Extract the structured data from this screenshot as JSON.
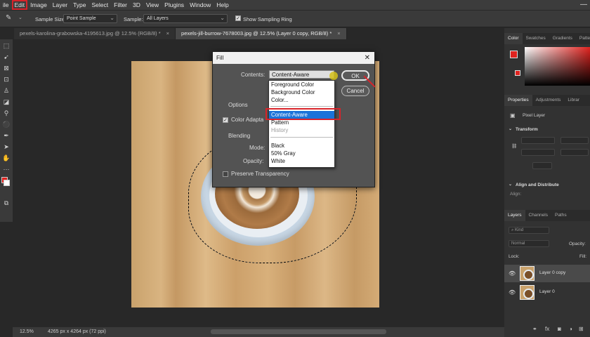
{
  "menu": [
    "ile",
    "Edit",
    "Image",
    "Layer",
    "Type",
    "Select",
    "Filter",
    "3D",
    "View",
    "Plugins",
    "Window",
    "Help"
  ],
  "options_bar": {
    "sample_size_label": "Sample Size:",
    "sample_size_value": "Point Sample",
    "sample_label": "Sample:",
    "sample_value": "All Layers",
    "show_ring_label": "Show Sampling Ring"
  },
  "tabs": [
    {
      "label": "pexels-karolina-grabowska-4195613.jpg @ 12.5% (RGB/8) *"
    },
    {
      "label": "pexels-jill-burrow-7678003.jpg @ 12.5% (Layer 0 copy, RGB/8) *"
    }
  ],
  "status": {
    "zoom": "12.5%",
    "doc_info": "4265 px x 4264 px (72 ppi)"
  },
  "panels": {
    "color_tabs": [
      "Color",
      "Swatches",
      "Gradients",
      "Patte"
    ],
    "prop_tabs": [
      "Properties",
      "Adjustments",
      "Librar"
    ],
    "pixel_layer": "Pixel Layer",
    "transform": "Transform",
    "align": "Align and Distribute",
    "align_label": "Align:",
    "layer_tabs": [
      "Layers",
      "Channels",
      "Paths"
    ],
    "kind_label": "Kind",
    "blend_mode": "Normal",
    "opacity_label": "Opacity:",
    "lock_label": "Lock:",
    "fill_label": "Fill:",
    "layers": [
      {
        "name": "Layer 0 copy"
      },
      {
        "name": "Layer 0"
      }
    ]
  },
  "dialog": {
    "title": "Fill",
    "close": "✕",
    "contents_label": "Contents:",
    "contents_value": "Content-Aware",
    "ok": "OK",
    "cancel": "Cancel",
    "options_label": "Options",
    "color_adapt": "Color Adapta",
    "blending_label": "Blending",
    "mode_label": "Mode:",
    "opacity_label": "Opacity:",
    "preserve": "Preserve Transparency",
    "dropdown": [
      "Foreground Color",
      "Background Color",
      "Color...",
      "Content-Aware",
      "Pattern",
      "History",
      "Black",
      "50% Gray",
      "White"
    ]
  },
  "colors": {
    "highlight_red": "#d8232a",
    "selection_blue": "#1a73d9",
    "fg_color": "#e0231f"
  }
}
